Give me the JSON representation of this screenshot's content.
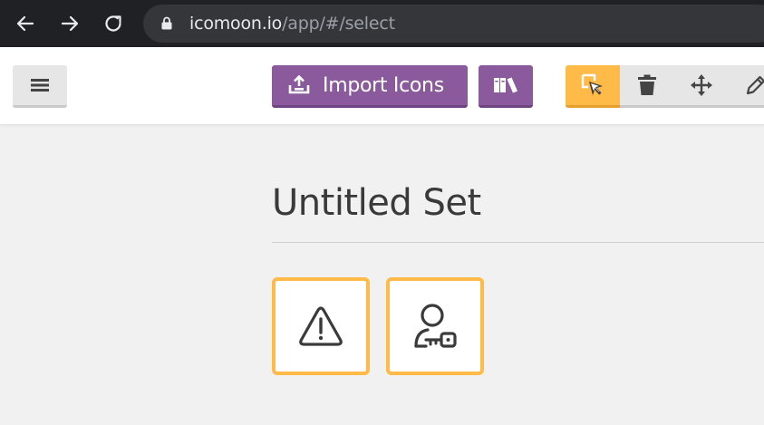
{
  "browser": {
    "url_host": "icomoon.io",
    "url_path": "/app/#/select",
    "icons": [
      "back-arrow-icon",
      "forward-arrow-icon",
      "reload-icon",
      "lock-icon"
    ]
  },
  "toolbar": {
    "import_label": "Import Icons",
    "icons": {
      "menu": "hamburger-icon",
      "import": "upload-icon",
      "library": "books-icon",
      "modes": [
        "select-cursor-icon",
        "trash-icon",
        "move-arrows-icon",
        "pencil-icon"
      ]
    },
    "active_mode": "select"
  },
  "main": {
    "set_title": "Untitled Set",
    "glyphs": [
      {
        "icon": "warning-triangle-icon",
        "selected": true
      },
      {
        "icon": "user-key-icon",
        "selected": true
      }
    ]
  },
  "colors": {
    "browser_bg": "#202124",
    "address_bg": "#35363a",
    "purple": "#8b5a9c",
    "orange": "#ffba48",
    "page_bg": "#f1f1f1"
  }
}
